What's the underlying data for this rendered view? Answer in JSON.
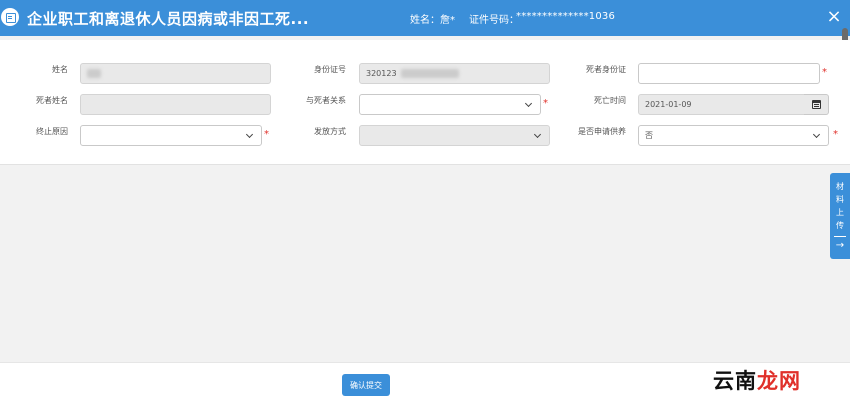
{
  "header": {
    "title": "企业职工和离退休人员因病或非因工死...",
    "name_label": "姓名：",
    "name_value": "詹*",
    "id_label": "证件号码：",
    "id_value": "**************1036",
    "icon": "list-icon",
    "close_label": "×"
  },
  "form": {
    "name_label": "姓名",
    "id_number_label": "身份证号",
    "id_number_value": "320123",
    "deceased_id_label": "死者身份证",
    "deceased_id_value": "",
    "deceased_name_label": "死者姓名",
    "relation_label": "与死者关系",
    "relation_value": "",
    "death_time_label": "死亡时间",
    "death_time_value": "2021-01-09",
    "termination_reason_label": "终止原因",
    "termination_reason_value": "",
    "payment_method_label": "发放方式",
    "payment_method_value": "",
    "support_label": "是否申请供养",
    "support_value": "否",
    "required_mark": "*"
  },
  "side_tab": {
    "label": "材料上传",
    "arrow": "→"
  },
  "footer": {
    "confirm_label": "确认提交"
  },
  "watermark": {
    "text_main": "云南",
    "text_accent": "龙网"
  },
  "colors": {
    "primary": "#3b8fd9",
    "required": "#e0302a"
  }
}
